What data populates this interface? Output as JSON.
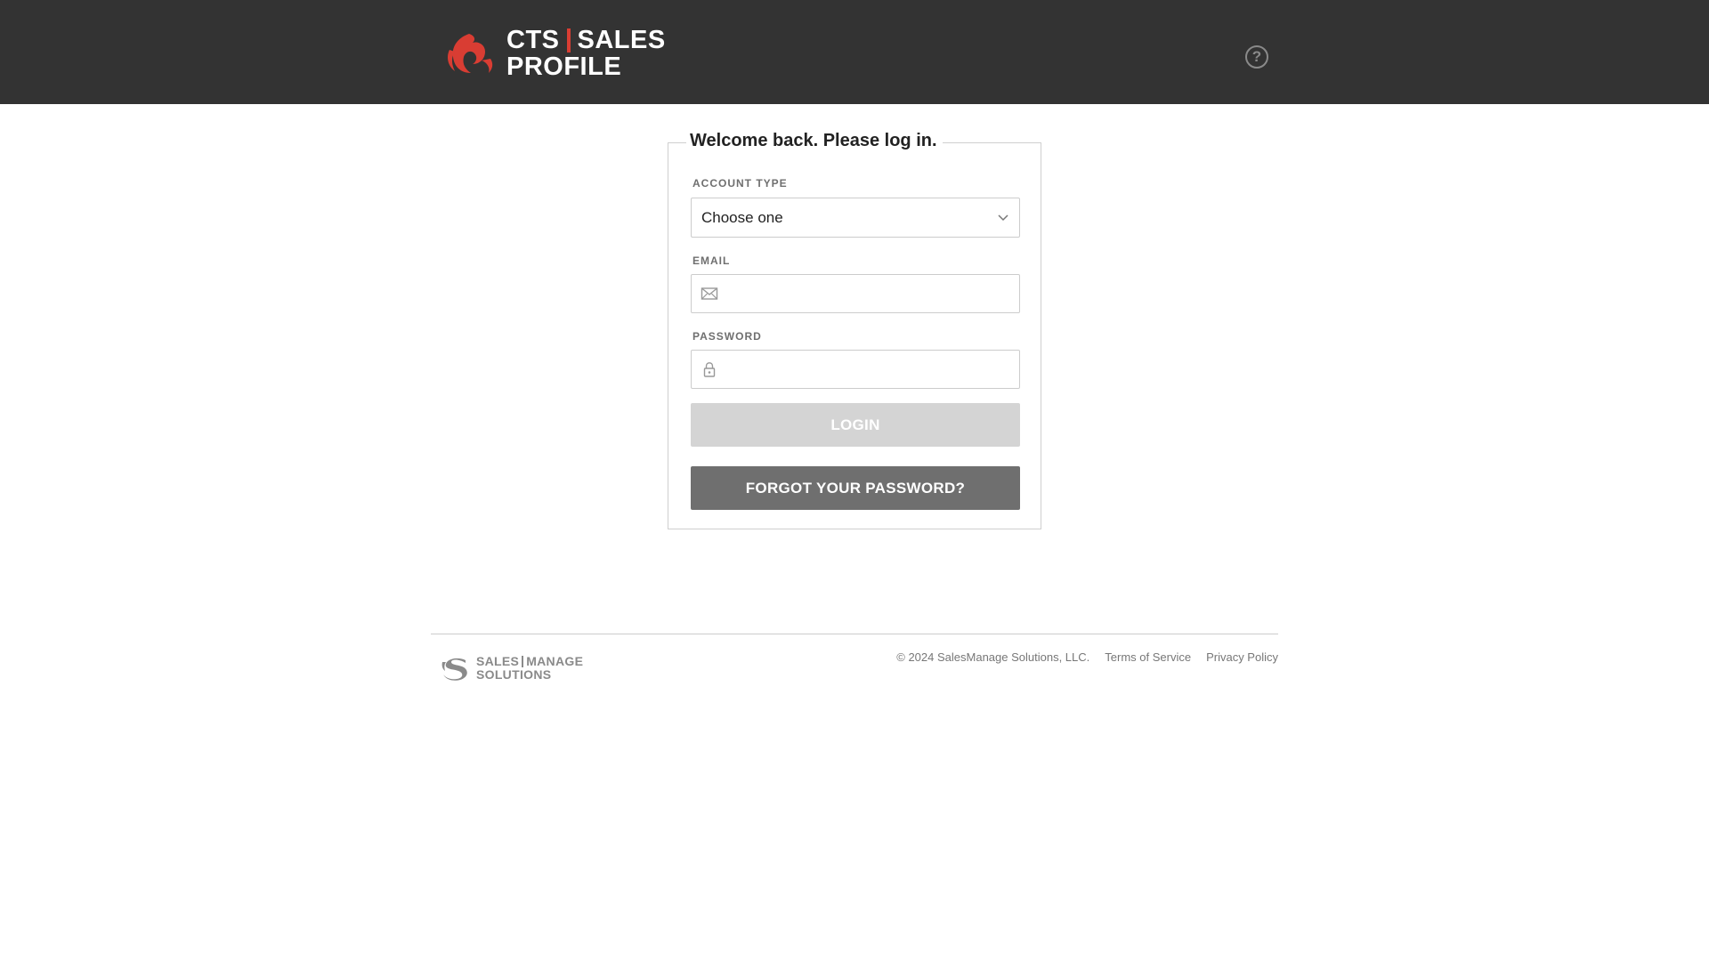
{
  "header": {
    "logo": {
      "line1_left": "CTS",
      "line1_right": "SALES",
      "line2": "PROFILE",
      "accent_color": "#d93d33"
    },
    "help_icon": "question-circle-icon",
    "help_glyph": "?"
  },
  "login": {
    "title": "Welcome back. Please log in.",
    "account_type": {
      "label": "ACCOUNT TYPE",
      "selected": "Choose one"
    },
    "email": {
      "label": "EMAIL",
      "value": "",
      "icon": "envelope-icon"
    },
    "password": {
      "label": "PASSWORD",
      "value": "",
      "icon": "lock-icon"
    },
    "login_button": "LOGIN",
    "forgot_button": "FORGOT YOUR PASSWORD?"
  },
  "footer": {
    "logo": {
      "line1_left": "SALES",
      "line1_right": "MANAGE",
      "line2": "SOLUTIONS"
    },
    "copyright": "© 2024 SalesManage Solutions, LLC.",
    "terms": "Terms of Service",
    "privacy": "Privacy Policy"
  },
  "colors": {
    "header_bg": "#333333",
    "login_disabled": "#d4d4d4",
    "forgot_bg": "#6f6f6f"
  }
}
